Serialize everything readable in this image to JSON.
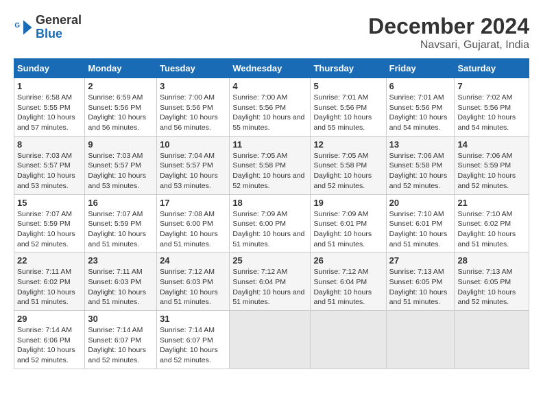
{
  "logo": {
    "line1": "General",
    "line2": "Blue"
  },
  "title": "December 2024",
  "subtitle": "Navsari, Gujarat, India",
  "headers": [
    "Sunday",
    "Monday",
    "Tuesday",
    "Wednesday",
    "Thursday",
    "Friday",
    "Saturday"
  ],
  "weeks": [
    [
      {
        "num": "1",
        "rise": "6:58 AM",
        "set": "5:55 PM",
        "daylight": "10 hours and 57 minutes."
      },
      {
        "num": "2",
        "rise": "6:59 AM",
        "set": "5:56 PM",
        "daylight": "10 hours and 56 minutes."
      },
      {
        "num": "3",
        "rise": "7:00 AM",
        "set": "5:56 PM",
        "daylight": "10 hours and 56 minutes."
      },
      {
        "num": "4",
        "rise": "7:00 AM",
        "set": "5:56 PM",
        "daylight": "10 hours and 55 minutes."
      },
      {
        "num": "5",
        "rise": "7:01 AM",
        "set": "5:56 PM",
        "daylight": "10 hours and 55 minutes."
      },
      {
        "num": "6",
        "rise": "7:01 AM",
        "set": "5:56 PM",
        "daylight": "10 hours and 54 minutes."
      },
      {
        "num": "7",
        "rise": "7:02 AM",
        "set": "5:56 PM",
        "daylight": "10 hours and 54 minutes."
      }
    ],
    [
      {
        "num": "8",
        "rise": "7:03 AM",
        "set": "5:57 PM",
        "daylight": "10 hours and 53 minutes."
      },
      {
        "num": "9",
        "rise": "7:03 AM",
        "set": "5:57 PM",
        "daylight": "10 hours and 53 minutes."
      },
      {
        "num": "10",
        "rise": "7:04 AM",
        "set": "5:57 PM",
        "daylight": "10 hours and 53 minutes."
      },
      {
        "num": "11",
        "rise": "7:05 AM",
        "set": "5:58 PM",
        "daylight": "10 hours and 52 minutes."
      },
      {
        "num": "12",
        "rise": "7:05 AM",
        "set": "5:58 PM",
        "daylight": "10 hours and 52 minutes."
      },
      {
        "num": "13",
        "rise": "7:06 AM",
        "set": "5:58 PM",
        "daylight": "10 hours and 52 minutes."
      },
      {
        "num": "14",
        "rise": "7:06 AM",
        "set": "5:59 PM",
        "daylight": "10 hours and 52 minutes."
      }
    ],
    [
      {
        "num": "15",
        "rise": "7:07 AM",
        "set": "5:59 PM",
        "daylight": "10 hours and 52 minutes."
      },
      {
        "num": "16",
        "rise": "7:07 AM",
        "set": "5:59 PM",
        "daylight": "10 hours and 51 minutes."
      },
      {
        "num": "17",
        "rise": "7:08 AM",
        "set": "6:00 PM",
        "daylight": "10 hours and 51 minutes."
      },
      {
        "num": "18",
        "rise": "7:09 AM",
        "set": "6:00 PM",
        "daylight": "10 hours and 51 minutes."
      },
      {
        "num": "19",
        "rise": "7:09 AM",
        "set": "6:01 PM",
        "daylight": "10 hours and 51 minutes."
      },
      {
        "num": "20",
        "rise": "7:10 AM",
        "set": "6:01 PM",
        "daylight": "10 hours and 51 minutes."
      },
      {
        "num": "21",
        "rise": "7:10 AM",
        "set": "6:02 PM",
        "daylight": "10 hours and 51 minutes."
      }
    ],
    [
      {
        "num": "22",
        "rise": "7:11 AM",
        "set": "6:02 PM",
        "daylight": "10 hours and 51 minutes."
      },
      {
        "num": "23",
        "rise": "7:11 AM",
        "set": "6:03 PM",
        "daylight": "10 hours and 51 minutes."
      },
      {
        "num": "24",
        "rise": "7:12 AM",
        "set": "6:03 PM",
        "daylight": "10 hours and 51 minutes."
      },
      {
        "num": "25",
        "rise": "7:12 AM",
        "set": "6:04 PM",
        "daylight": "10 hours and 51 minutes."
      },
      {
        "num": "26",
        "rise": "7:12 AM",
        "set": "6:04 PM",
        "daylight": "10 hours and 51 minutes."
      },
      {
        "num": "27",
        "rise": "7:13 AM",
        "set": "6:05 PM",
        "daylight": "10 hours and 51 minutes."
      },
      {
        "num": "28",
        "rise": "7:13 AM",
        "set": "6:05 PM",
        "daylight": "10 hours and 52 minutes."
      }
    ],
    [
      {
        "num": "29",
        "rise": "7:14 AM",
        "set": "6:06 PM",
        "daylight": "10 hours and 52 minutes."
      },
      {
        "num": "30",
        "rise": "7:14 AM",
        "set": "6:07 PM",
        "daylight": "10 hours and 52 minutes."
      },
      {
        "num": "31",
        "rise": "7:14 AM",
        "set": "6:07 PM",
        "daylight": "10 hours and 52 minutes."
      },
      null,
      null,
      null,
      null
    ]
  ]
}
